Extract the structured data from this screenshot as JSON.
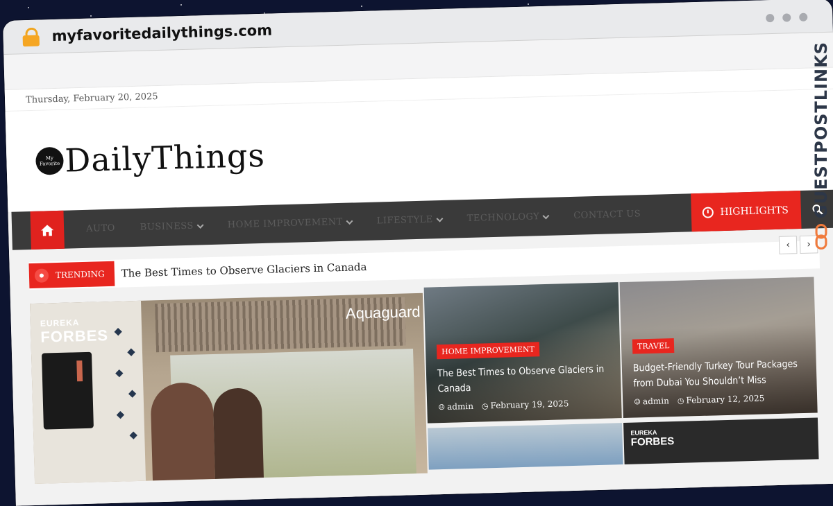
{
  "browser": {
    "url": "myfavoritedailythings.com"
  },
  "topbar": {
    "date": "Thursday, February 20, 2025"
  },
  "site": {
    "logo_badge_line1": "My",
    "logo_badge_line2": "Favorite",
    "logo_text": "DailyThings"
  },
  "nav": {
    "items": [
      {
        "label": "AUTO",
        "has_dropdown": false
      },
      {
        "label": "BUSINESS",
        "has_dropdown": true
      },
      {
        "label": "HOME IMPROVEMENT",
        "has_dropdown": true
      },
      {
        "label": "LIFESTYLE",
        "has_dropdown": true
      },
      {
        "label": "TECHNOLOGY",
        "has_dropdown": true
      },
      {
        "label": "CONTACT US",
        "has_dropdown": false
      }
    ],
    "highlights_label": "HIGHLIGHTS",
    "home_icon": "home-icon",
    "search_icon": "search-icon"
  },
  "trending": {
    "label": "TRENDING",
    "headline": "The Best Times to Observe Glaciers in Canada",
    "prev": "‹",
    "next": "›"
  },
  "feature": {
    "brand_line1": "EUREKA",
    "brand_line2": "FORBES",
    "product": "Aquaguard"
  },
  "cards": [
    {
      "category": "HOME IMPROVEMENT",
      "title": "The Best Times to Observe Glaciers in Canada",
      "author": "admin",
      "date": "February 19, 2025"
    },
    {
      "category": "TRAVEL",
      "title": "Budget-Friendly Turkey Tour Packages from Dubai You Shouldn’t Miss",
      "author": "admin",
      "date": "February 12, 2025"
    }
  ],
  "card4": {
    "brand_line1": "EUREKA",
    "brand_line2": "FORBES"
  },
  "stamp": {
    "text": "GUESTPOSTLINKS"
  },
  "colors": {
    "accent_red": "#e8261f",
    "nav_bg": "#3a3a3a",
    "background": "#0d1430"
  }
}
